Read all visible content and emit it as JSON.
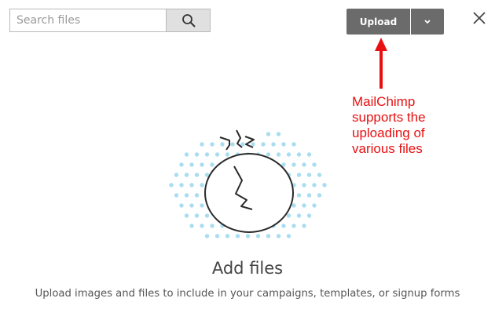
{
  "search": {
    "placeholder": "Search files",
    "value": "",
    "icon": "search-icon"
  },
  "toolbar": {
    "upload_label": "Upload",
    "upload_menu_icon": "chevron-down-icon",
    "close_icon": "close-icon"
  },
  "annotation": {
    "text": "MailChimp\nsupports the\nuploading of\nvarious files",
    "color": "#e81010",
    "icon": "arrow-up-icon"
  },
  "empty_state": {
    "illustration": "cracked-egg-illustration",
    "title": "Add files",
    "description": "Upload images and files to include in your campaigns, templates, or signup forms"
  },
  "colors": {
    "button_bg": "#6b6b6b",
    "dots": "#a9ddf0"
  }
}
